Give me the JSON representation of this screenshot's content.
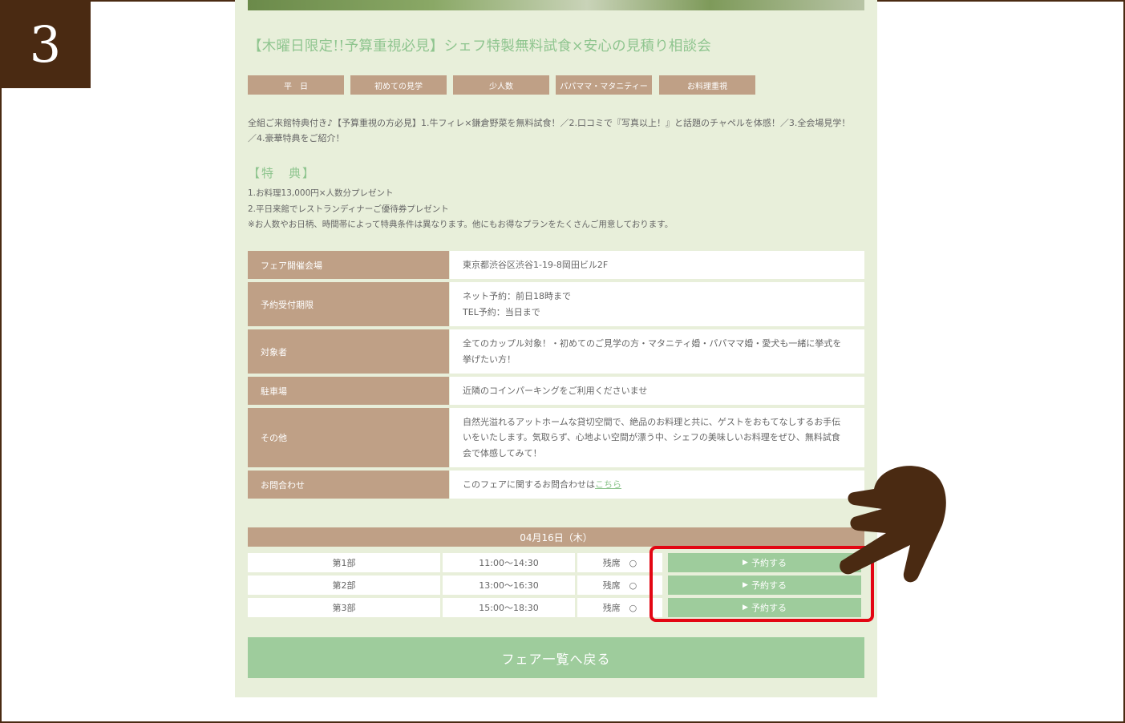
{
  "step": {
    "number": "3"
  },
  "fair": {
    "title": "【木曜日限定!!予算重視必見】シェフ特製無料試食×安心の見積り相談会",
    "tags": [
      "平　日",
      "初めての見学",
      "少人数",
      "パパママ・マタニティー",
      "お料理重視"
    ],
    "description_line1": "全組ご来館特典付き♪【予算重視の方必見】1.牛フィレ×鎌倉野菜を無料試食！／2.口コミで『写真以上！』と話題のチャペルを体感！／3.全会場見学！",
    "description_line2": "／4.豪華特典をご紹介！",
    "benefits_heading": "【特　典】",
    "benefits": [
      "1.お料理13,000円×人数分プレゼント",
      "2.平日来館でレストランディナーご優待券プレゼント",
      "※お人数やお日柄、時間帯によって特典条件は異なります。他にもお得なプランをたくさんご用意しております。"
    ]
  },
  "info": {
    "rows": [
      {
        "label": "フェア開催会場",
        "value": "東京都渋谷区渋谷1-19-8岡田ビル2F"
      },
      {
        "label": "予約受付期限",
        "value": "ネット予約：前日18時まで",
        "value2": "TEL予約：当日まで"
      },
      {
        "label": "対象者",
        "value": "全てのカップル対象！・初めてのご見学の方・マタニティ婚・パパママ婚・愛犬も一緒に挙式を",
        "value2": "挙げたい方！"
      },
      {
        "label": "駐車場",
        "value": "近隣のコインパーキングをご利用くださいませ"
      },
      {
        "label": "その他",
        "value": "自然光溢れるアットホームな貸切空間で、絶品のお料理と共に、ゲストをおもてなしするお手伝",
        "value2": "いをいたします。気取らず、心地よい空間が漂う中、シェフの美味しいお料理をぜひ、無料試食",
        "value3": "会で体感してみて！"
      },
      {
        "label": "お問合わせ",
        "value": "このフェアに関するお問合わせは",
        "link": "こちら"
      }
    ]
  },
  "schedule": {
    "date": "04月16日（木）",
    "slots": [
      {
        "part": "第1部",
        "time": "11:00〜14:30",
        "seats": "残席　○",
        "button": "予約する"
      },
      {
        "part": "第2部",
        "time": "13:00〜16:30",
        "seats": "残席　○",
        "button": "予約する"
      },
      {
        "part": "第3部",
        "time": "15:00〜18:30",
        "seats": "残席　○",
        "button": "予約する"
      }
    ]
  },
  "back_button": "フェア一覧へ戻る",
  "colors": {
    "accent_green": "#9ecc9c",
    "label_brown": "#bfa086",
    "badge_brown": "#4a2a12",
    "highlight_red": "#e30613",
    "panel_bg": "#e8efda"
  },
  "icons": {
    "pointer": "pointing-hand-icon",
    "play": "play-triangle-icon"
  }
}
